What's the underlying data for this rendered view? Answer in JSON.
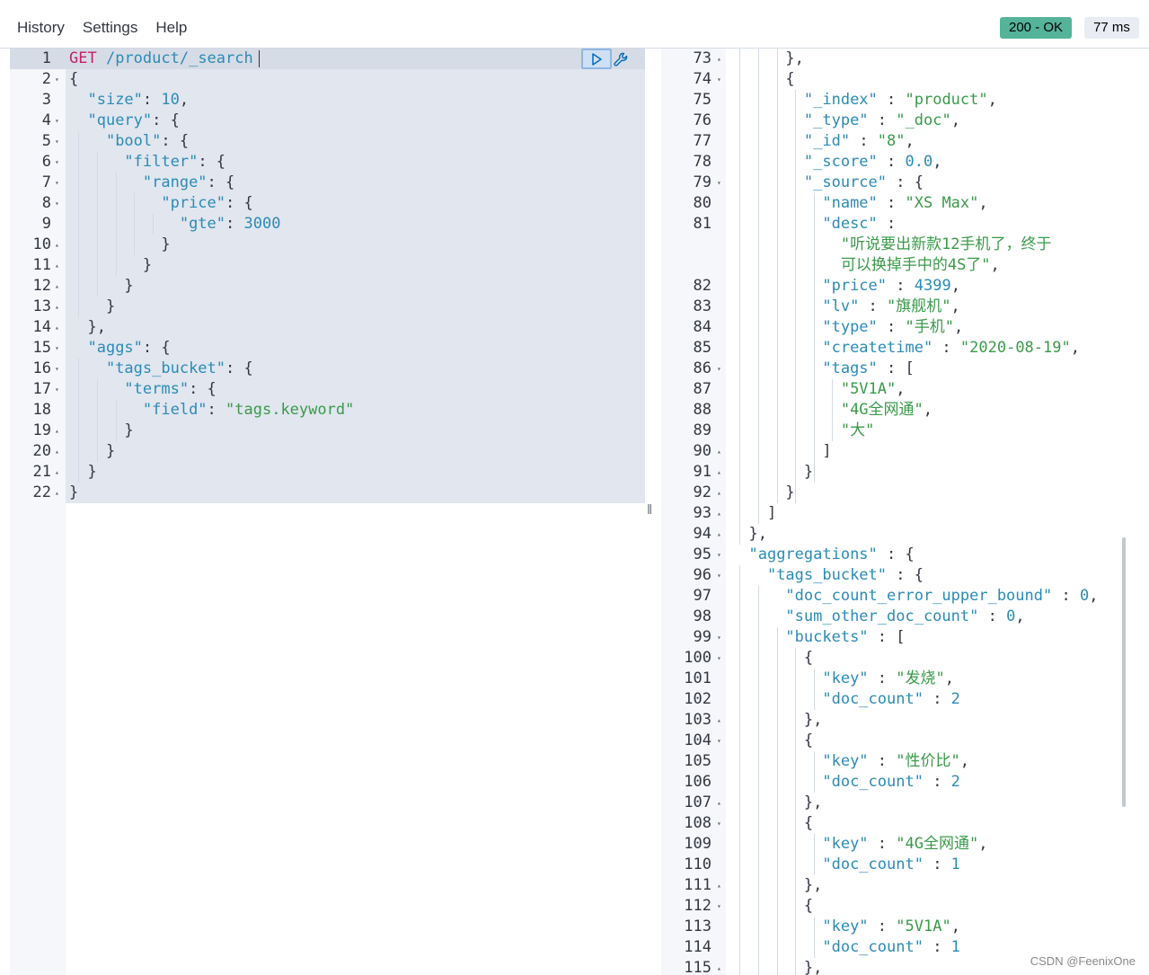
{
  "menu": {
    "history": "History",
    "settings": "Settings",
    "help": "Help"
  },
  "status": {
    "code": "200 - OK",
    "time": "77 ms"
  },
  "request": {
    "lines": [
      {
        "n": "1",
        "f": "",
        "parts": [
          [
            "m",
            "GET"
          ],
          [
            "p",
            " "
          ],
          [
            "u",
            "/product/_search"
          ]
        ]
      },
      {
        "n": "2",
        "f": "▾",
        "parts": [
          [
            "p",
            "{"
          ]
        ]
      },
      {
        "n": "3",
        "f": "",
        "parts": [
          [
            "p",
            "  "
          ],
          [
            "k",
            "\"size\""
          ],
          [
            "p",
            ": "
          ],
          [
            "n",
            "10"
          ],
          [
            "p",
            ","
          ]
        ]
      },
      {
        "n": "4",
        "f": "▾",
        "parts": [
          [
            "p",
            "  "
          ],
          [
            "k",
            "\"query\""
          ],
          [
            "p",
            ": {"
          ]
        ]
      },
      {
        "n": "5",
        "f": "▾",
        "parts": [
          [
            "p",
            "    "
          ],
          [
            "k",
            "\"bool\""
          ],
          [
            "p",
            ": {"
          ]
        ]
      },
      {
        "n": "6",
        "f": "▾",
        "parts": [
          [
            "p",
            "      "
          ],
          [
            "k",
            "\"filter\""
          ],
          [
            "p",
            ": {"
          ]
        ]
      },
      {
        "n": "7",
        "f": "▾",
        "parts": [
          [
            "p",
            "        "
          ],
          [
            "k",
            "\"range\""
          ],
          [
            "p",
            ": {"
          ]
        ]
      },
      {
        "n": "8",
        "f": "▾",
        "parts": [
          [
            "p",
            "          "
          ],
          [
            "k",
            "\"price\""
          ],
          [
            "p",
            ": {"
          ]
        ]
      },
      {
        "n": "9",
        "f": "",
        "parts": [
          [
            "p",
            "            "
          ],
          [
            "k",
            "\"gte\""
          ],
          [
            "p",
            ": "
          ],
          [
            "n",
            "3000"
          ]
        ]
      },
      {
        "n": "10",
        "f": "▴",
        "parts": [
          [
            "p",
            "          }"
          ]
        ]
      },
      {
        "n": "11",
        "f": "▴",
        "parts": [
          [
            "p",
            "        }"
          ]
        ]
      },
      {
        "n": "12",
        "f": "▴",
        "parts": [
          [
            "p",
            "      }"
          ]
        ]
      },
      {
        "n": "13",
        "f": "▴",
        "parts": [
          [
            "p",
            "    }"
          ]
        ]
      },
      {
        "n": "14",
        "f": "▴",
        "parts": [
          [
            "p",
            "  },"
          ]
        ]
      },
      {
        "n": "15",
        "f": "▾",
        "parts": [
          [
            "p",
            "  "
          ],
          [
            "k",
            "\"aggs\""
          ],
          [
            "p",
            ": {"
          ]
        ]
      },
      {
        "n": "16",
        "f": "▾",
        "parts": [
          [
            "p",
            "    "
          ],
          [
            "k",
            "\"tags_bucket\""
          ],
          [
            "p",
            ": {"
          ]
        ]
      },
      {
        "n": "17",
        "f": "▾",
        "parts": [
          [
            "p",
            "      "
          ],
          [
            "k",
            "\"terms\""
          ],
          [
            "p",
            ": {"
          ]
        ]
      },
      {
        "n": "18",
        "f": "",
        "parts": [
          [
            "p",
            "        "
          ],
          [
            "k",
            "\"field\""
          ],
          [
            "p",
            ": "
          ],
          [
            "s",
            "\"tags.keyword\""
          ]
        ]
      },
      {
        "n": "19",
        "f": "▴",
        "parts": [
          [
            "p",
            "      }"
          ]
        ]
      },
      {
        "n": "20",
        "f": "▴",
        "parts": [
          [
            "p",
            "    }"
          ]
        ]
      },
      {
        "n": "21",
        "f": "▴",
        "parts": [
          [
            "p",
            "  }"
          ]
        ]
      },
      {
        "n": "22",
        "f": "▴",
        "parts": [
          [
            "p",
            "}"
          ]
        ]
      }
    ]
  },
  "response": {
    "lines": [
      {
        "n": "73",
        "f": "▴",
        "parts": [
          [
            "p",
            "      },"
          ]
        ]
      },
      {
        "n": "74",
        "f": "▾",
        "parts": [
          [
            "p",
            "      {"
          ]
        ]
      },
      {
        "n": "75",
        "f": "",
        "parts": [
          [
            "p",
            "        "
          ],
          [
            "k",
            "\"_index\""
          ],
          [
            "p",
            " : "
          ],
          [
            "s",
            "\"product\""
          ],
          [
            "p",
            ","
          ]
        ]
      },
      {
        "n": "76",
        "f": "",
        "parts": [
          [
            "p",
            "        "
          ],
          [
            "k",
            "\"_type\""
          ],
          [
            "p",
            " : "
          ],
          [
            "s",
            "\"_doc\""
          ],
          [
            "p",
            ","
          ]
        ]
      },
      {
        "n": "77",
        "f": "",
        "parts": [
          [
            "p",
            "        "
          ],
          [
            "k",
            "\"_id\""
          ],
          [
            "p",
            " : "
          ],
          [
            "s",
            "\"8\""
          ],
          [
            "p",
            ","
          ]
        ]
      },
      {
        "n": "78",
        "f": "",
        "parts": [
          [
            "p",
            "        "
          ],
          [
            "k",
            "\"_score\""
          ],
          [
            "p",
            " : "
          ],
          [
            "n",
            "0.0"
          ],
          [
            "p",
            ","
          ]
        ]
      },
      {
        "n": "79",
        "f": "▾",
        "parts": [
          [
            "p",
            "        "
          ],
          [
            "k",
            "\"_source\""
          ],
          [
            "p",
            " : {"
          ]
        ]
      },
      {
        "n": "80",
        "f": "",
        "parts": [
          [
            "p",
            "          "
          ],
          [
            "k",
            "\"name\""
          ],
          [
            "p",
            " : "
          ],
          [
            "s",
            "\"XS Max\""
          ],
          [
            "p",
            ","
          ]
        ]
      },
      {
        "n": "81",
        "f": "",
        "parts": [
          [
            "p",
            "          "
          ],
          [
            "k",
            "\"desc\""
          ],
          [
            "p",
            " :"
          ]
        ]
      },
      {
        "n": "",
        "f": "",
        "parts": [
          [
            "p",
            "            "
          ],
          [
            "s",
            "\"听说要出新款12手机了，终于"
          ]
        ]
      },
      {
        "n": "",
        "f": "",
        "parts": [
          [
            "p",
            "            "
          ],
          [
            "s",
            "可以换掉手中的4S了\""
          ],
          [
            "p",
            ","
          ]
        ]
      },
      {
        "n": "82",
        "f": "",
        "parts": [
          [
            "p",
            "          "
          ],
          [
            "k",
            "\"price\""
          ],
          [
            "p",
            " : "
          ],
          [
            "n",
            "4399"
          ],
          [
            "p",
            ","
          ]
        ]
      },
      {
        "n": "83",
        "f": "",
        "parts": [
          [
            "p",
            "          "
          ],
          [
            "k",
            "\"lv\""
          ],
          [
            "p",
            " : "
          ],
          [
            "s",
            "\"旗舰机\""
          ],
          [
            "p",
            ","
          ]
        ]
      },
      {
        "n": "84",
        "f": "",
        "parts": [
          [
            "p",
            "          "
          ],
          [
            "k",
            "\"type\""
          ],
          [
            "p",
            " : "
          ],
          [
            "s",
            "\"手机\""
          ],
          [
            "p",
            ","
          ]
        ]
      },
      {
        "n": "85",
        "f": "",
        "parts": [
          [
            "p",
            "          "
          ],
          [
            "k",
            "\"createtime\""
          ],
          [
            "p",
            " : "
          ],
          [
            "s",
            "\"2020-08-19\""
          ],
          [
            "p",
            ","
          ]
        ]
      },
      {
        "n": "86",
        "f": "▾",
        "parts": [
          [
            "p",
            "          "
          ],
          [
            "k",
            "\"tags\""
          ],
          [
            "p",
            " : ["
          ]
        ]
      },
      {
        "n": "87",
        "f": "",
        "parts": [
          [
            "p",
            "            "
          ],
          [
            "s",
            "\"5V1A\""
          ],
          [
            "p",
            ","
          ]
        ]
      },
      {
        "n": "88",
        "f": "",
        "parts": [
          [
            "p",
            "            "
          ],
          [
            "s",
            "\"4G全网通\""
          ],
          [
            "p",
            ","
          ]
        ]
      },
      {
        "n": "89",
        "f": "",
        "parts": [
          [
            "p",
            "            "
          ],
          [
            "s",
            "\"大\""
          ]
        ]
      },
      {
        "n": "90",
        "f": "▴",
        "parts": [
          [
            "p",
            "          ]"
          ]
        ]
      },
      {
        "n": "91",
        "f": "▴",
        "parts": [
          [
            "p",
            "        }"
          ]
        ]
      },
      {
        "n": "92",
        "f": "▴",
        "parts": [
          [
            "p",
            "      }"
          ]
        ]
      },
      {
        "n": "93",
        "f": "▴",
        "parts": [
          [
            "p",
            "    ]"
          ]
        ]
      },
      {
        "n": "94",
        "f": "▴",
        "parts": [
          [
            "p",
            "  },"
          ]
        ]
      },
      {
        "n": "95",
        "f": "▾",
        "parts": [
          [
            "p",
            "  "
          ],
          [
            "k",
            "\"aggregations\""
          ],
          [
            "p",
            " : {"
          ]
        ]
      },
      {
        "n": "96",
        "f": "▾",
        "parts": [
          [
            "p",
            "    "
          ],
          [
            "k",
            "\"tags_bucket\""
          ],
          [
            "p",
            " : {"
          ]
        ]
      },
      {
        "n": "97",
        "f": "",
        "parts": [
          [
            "p",
            "      "
          ],
          [
            "k",
            "\"doc_count_error_upper_bound\""
          ],
          [
            "p",
            " : "
          ],
          [
            "n",
            "0"
          ],
          [
            "p",
            ","
          ]
        ]
      },
      {
        "n": "98",
        "f": "",
        "parts": [
          [
            "p",
            "      "
          ],
          [
            "k",
            "\"sum_other_doc_count\""
          ],
          [
            "p",
            " : "
          ],
          [
            "n",
            "0"
          ],
          [
            "p",
            ","
          ]
        ]
      },
      {
        "n": "99",
        "f": "▾",
        "parts": [
          [
            "p",
            "      "
          ],
          [
            "k",
            "\"buckets\""
          ],
          [
            "p",
            " : ["
          ]
        ]
      },
      {
        "n": "100",
        "f": "▾",
        "parts": [
          [
            "p",
            "        {"
          ]
        ]
      },
      {
        "n": "101",
        "f": "",
        "parts": [
          [
            "p",
            "          "
          ],
          [
            "k",
            "\"key\""
          ],
          [
            "p",
            " : "
          ],
          [
            "s",
            "\"发烧\""
          ],
          [
            "p",
            ","
          ]
        ]
      },
      {
        "n": "102",
        "f": "",
        "parts": [
          [
            "p",
            "          "
          ],
          [
            "k",
            "\"doc_count\""
          ],
          [
            "p",
            " : "
          ],
          [
            "n",
            "2"
          ]
        ]
      },
      {
        "n": "103",
        "f": "▴",
        "parts": [
          [
            "p",
            "        },"
          ]
        ]
      },
      {
        "n": "104",
        "f": "▾",
        "parts": [
          [
            "p",
            "        {"
          ]
        ]
      },
      {
        "n": "105",
        "f": "",
        "parts": [
          [
            "p",
            "          "
          ],
          [
            "k",
            "\"key\""
          ],
          [
            "p",
            " : "
          ],
          [
            "s",
            "\"性价比\""
          ],
          [
            "p",
            ","
          ]
        ]
      },
      {
        "n": "106",
        "f": "",
        "parts": [
          [
            "p",
            "          "
          ],
          [
            "k",
            "\"doc_count\""
          ],
          [
            "p",
            " : "
          ],
          [
            "n",
            "2"
          ]
        ]
      },
      {
        "n": "107",
        "f": "▴",
        "parts": [
          [
            "p",
            "        },"
          ]
        ]
      },
      {
        "n": "108",
        "f": "▾",
        "parts": [
          [
            "p",
            "        {"
          ]
        ]
      },
      {
        "n": "109",
        "f": "",
        "parts": [
          [
            "p",
            "          "
          ],
          [
            "k",
            "\"key\""
          ],
          [
            "p",
            " : "
          ],
          [
            "s",
            "\"4G全网通\""
          ],
          [
            "p",
            ","
          ]
        ]
      },
      {
        "n": "110",
        "f": "",
        "parts": [
          [
            "p",
            "          "
          ],
          [
            "k",
            "\"doc_count\""
          ],
          [
            "p",
            " : "
          ],
          [
            "n",
            "1"
          ]
        ]
      },
      {
        "n": "111",
        "f": "▴",
        "parts": [
          [
            "p",
            "        },"
          ]
        ]
      },
      {
        "n": "112",
        "f": "▾",
        "parts": [
          [
            "p",
            "        {"
          ]
        ]
      },
      {
        "n": "113",
        "f": "",
        "parts": [
          [
            "p",
            "          "
          ],
          [
            "k",
            "\"key\""
          ],
          [
            "p",
            " : "
          ],
          [
            "s",
            "\"5V1A\""
          ],
          [
            "p",
            ","
          ]
        ]
      },
      {
        "n": "114",
        "f": "",
        "parts": [
          [
            "p",
            "          "
          ],
          [
            "k",
            "\"doc_count\""
          ],
          [
            "p",
            " : "
          ],
          [
            "n",
            "1"
          ]
        ]
      },
      {
        "n": "115",
        "f": "▴",
        "parts": [
          [
            "p",
            "        },"
          ]
        ]
      }
    ]
  },
  "icons": {
    "run": "play-icon",
    "settings": "wrench-icon"
  },
  "watermark": "CSDN @FeenixOne"
}
